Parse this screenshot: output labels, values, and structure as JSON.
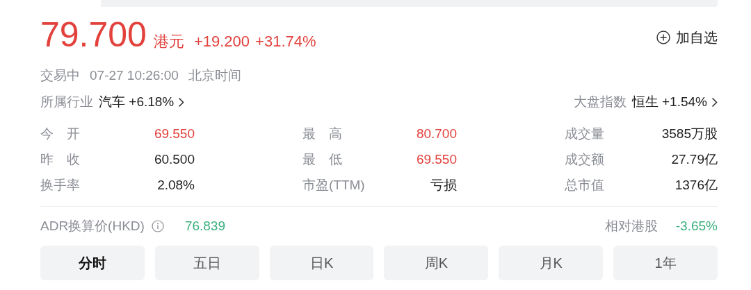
{
  "quote": {
    "price": "79.700",
    "currency": "港元",
    "change": "+19.200",
    "change_pct": "+31.74%",
    "color": "#e2413c"
  },
  "watch_button": {
    "label": "加自选"
  },
  "status": {
    "state": "交易中",
    "time": "07-27 10:26:00",
    "zone": "北京时间"
  },
  "industry": {
    "label": "所属行业",
    "name": "汽车",
    "change": "+6.18%"
  },
  "index": {
    "label": "大盘指数",
    "name": "恒生",
    "change": "+1.54%"
  },
  "stats": [
    {
      "label": "今　开",
      "value": "69.550",
      "color": "#e2413c"
    },
    {
      "label": "最　高",
      "value": "80.700",
      "color": "#e2413c"
    },
    {
      "label": "成交量",
      "value": "3585万股",
      "color": "#222222"
    },
    {
      "label": "昨　收",
      "value": "60.500",
      "color": "#222222"
    },
    {
      "label": "最　低",
      "value": "69.550",
      "color": "#e2413c"
    },
    {
      "label": "成交额",
      "value": "27.79亿",
      "color": "#222222"
    },
    {
      "label": "换手率",
      "value": "2.08%",
      "color": "#222222"
    },
    {
      "label": "市盈(TTM)",
      "value": "亏损",
      "color": "#222222"
    },
    {
      "label": "总市值",
      "value": "1376亿",
      "color": "#222222"
    }
  ],
  "adr": {
    "label": "ADR换算价(HKD)",
    "value": "76.839",
    "color": "#3ab07c",
    "relative": {
      "label": "相对港股",
      "value": "-3.65%",
      "color": "#3ab07c"
    }
  },
  "tabs": [
    {
      "label": "分时",
      "selected": true
    },
    {
      "label": "五日",
      "selected": false
    },
    {
      "label": "日K",
      "selected": false
    },
    {
      "label": "周K",
      "selected": false
    },
    {
      "label": "月K",
      "selected": false
    },
    {
      "label": "1年",
      "selected": false
    }
  ]
}
